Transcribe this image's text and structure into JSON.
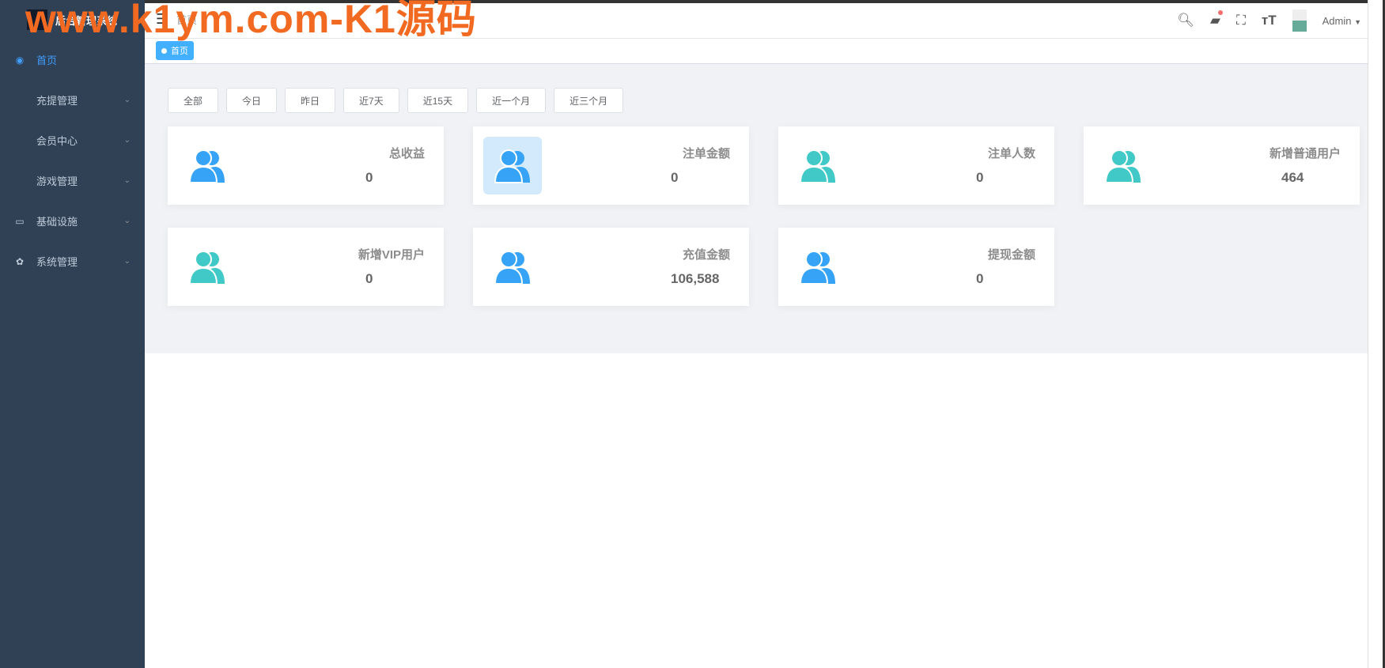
{
  "watermark": "www.k1ym.com-K1源码",
  "sidebar": {
    "logo_text": "后台管理系统",
    "items": [
      {
        "label": "首页",
        "active": true,
        "icon": "dashboard-icon",
        "expandable": false
      },
      {
        "label": "充提管理",
        "expandable": true
      },
      {
        "label": "会员中心",
        "expandable": true
      },
      {
        "label": "游戏管理",
        "expandable": true
      },
      {
        "label": "基础设施",
        "icon": "monitor-icon",
        "expandable": true
      },
      {
        "label": "系统管理",
        "icon": "gear-icon",
        "expandable": true
      }
    ]
  },
  "header": {
    "breadcrumb": "首页",
    "user": "Admin"
  },
  "tags": [
    {
      "label": "首页"
    }
  ],
  "filters": [
    "全部",
    "今日",
    "昨日",
    "近7天",
    "近15天",
    "近一个月",
    "近三个月"
  ],
  "cards": [
    {
      "label": "总收益",
      "value": "0",
      "color": "#36a3f7"
    },
    {
      "label": "注单金额",
      "value": "0",
      "color": "#36a3f7",
      "highlight": true
    },
    {
      "label": "注单人数",
      "value": "0",
      "color": "#40c9c6"
    },
    {
      "label": "新增普通用户",
      "value": "464",
      "color": "#40c9c6"
    },
    {
      "label": "新增VIP用户",
      "value": "0",
      "color": "#40c9c6"
    },
    {
      "label": "充值金额",
      "value": "106,588",
      "color": "#36a3f7"
    },
    {
      "label": "提现金额",
      "value": "0",
      "color": "#36a3f7"
    }
  ]
}
